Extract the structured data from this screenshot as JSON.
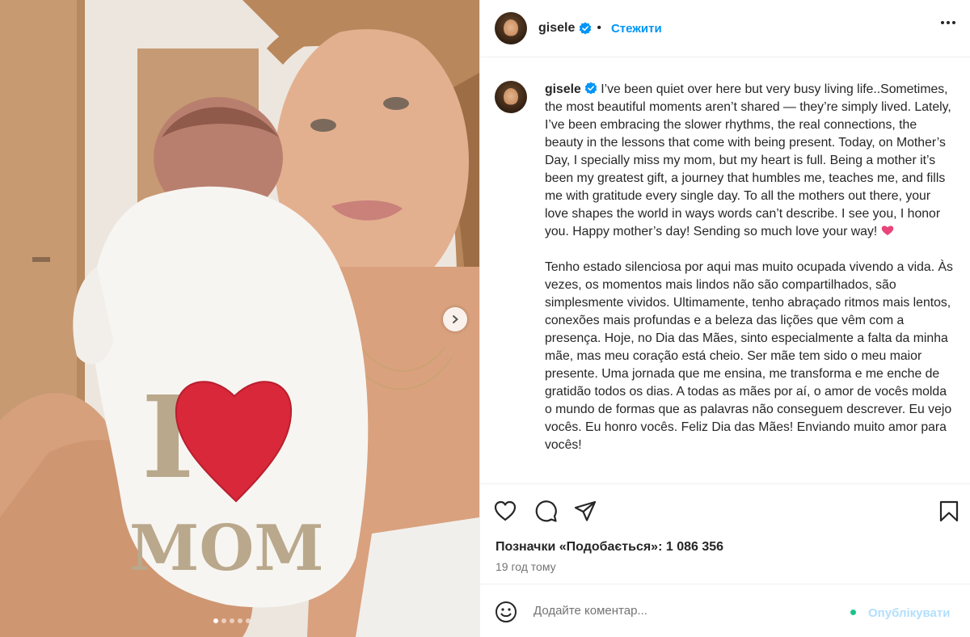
{
  "post": {
    "username": "gisele",
    "follow_label": "Стежити",
    "more_icon": "more-horizontal-icon"
  },
  "media": {
    "shirt_text_i": "I",
    "shirt_text_mom": "MOM",
    "carousel_count": 5,
    "carousel_active": 1
  },
  "caption": {
    "username": "gisele",
    "text_en": "I’ve been quiet over here but very busy living life..Sometimes, the most beautiful moments aren’t shared — they’re simply lived. Lately, I’ve been embracing the slower rhythms, the real connections, the beauty in the lessons that come with being present. Today, on Mother’s Day, I specially miss my mom, but my heart is full. Being a mother it’s been my greatest gift, a journey that humbles me, teaches me, and fills me with gratitude every single day. To all the mothers out there, your love shapes the world in ways words can’t describe. I see you, I honor you. Happy mother’s day! Sending so much love your way! ",
    "text_pt": "Tenho estado silenciosa por aqui mas muito ocupada vivendo a vida. Às vezes, os momentos mais lindos não são compartilhados, são simplesmente vividos. Ultimamente, tenho abraçado ritmos mais lentos, conexões mais profundas e a beleza das lições que vêm com a presença. Hoje, no Dia das Mães, sinto especialmente a falta da minha mãe, mas meu coração está cheio. Ser mãe tem sido o meu maior presente. Uma jornada que me ensina, me transforma e me enche de gratidão todos os dias. A todas as mães por aí, o amor de vocês molda o mundo de formas que as palavras não conseguem descrever. Eu vejo vocês. Eu honro vocês. Feliz Dia das Mães! Enviando muito amor para vocês!"
  },
  "stats": {
    "likes_label": "Позначки «Подобається»: 1 086 356",
    "time_ago": "19 год тому"
  },
  "comment": {
    "placeholder": "Додайте коментар...",
    "post_label": "Опублікувати"
  },
  "colors": {
    "accent": "#0095f6",
    "text": "#262626",
    "muted": "#737373",
    "heart": "#d8283a"
  }
}
